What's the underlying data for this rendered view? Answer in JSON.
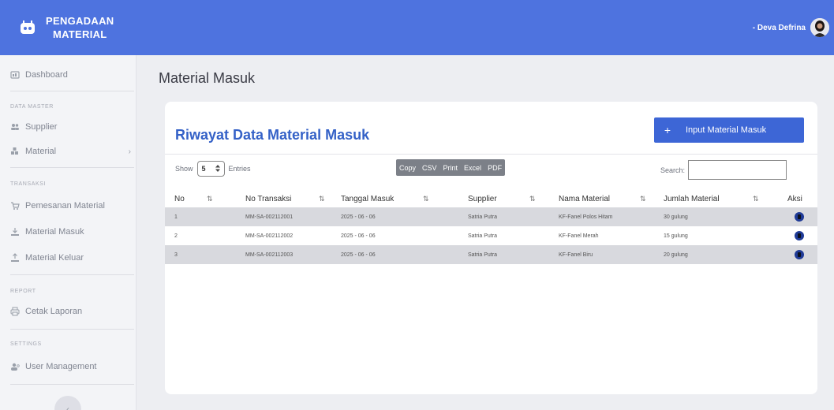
{
  "app": {
    "brand_line1": "PENGADAAN",
    "brand_line2": "MATERIAL",
    "user_name": "- Deva Defrina",
    "accent_color": "#4e73df"
  },
  "sidebar": {
    "dashboard": "Dashboard",
    "sec_master": "DATA MASTER",
    "supplier": "Supplier",
    "material": "Material",
    "sec_transaksi": "TRANSAKSI",
    "pemesanan": "Pemesanan Material",
    "masuk": "Material Masuk",
    "keluar": "Material Keluar",
    "sec_report": "REPORT",
    "cetak": "Cetak Laporan",
    "sec_settings": "SETTINGS",
    "user_mgmt": "User Management",
    "collapse": "‹"
  },
  "main": {
    "page_title": "Material Masuk",
    "card_title": "Riwayat Data Material Masuk",
    "input_button": "Input  Material Masuk",
    "show_label": "Show",
    "entries_label": "Entries",
    "page_size": "5",
    "export": [
      "Copy",
      "CSV",
      "Print",
      "Excel",
      "PDF"
    ],
    "search_label": "Search:"
  },
  "table": {
    "headers": [
      "No",
      "No Transaksi",
      "Tanggal Masuk",
      "Supplier",
      "Nama Material",
      "Jumlah Material",
      "Aksi"
    ],
    "rows": [
      {
        "no": "1",
        "trx": "MM-SA-002112001",
        "tgl": "2025 - 06 - 06",
        "supplier": "Satria Putra",
        "nama": "KF-Fanel Polos Hitam",
        "jumlah": "30 gulung"
      },
      {
        "no": "2",
        "trx": "MM-SA-002112002",
        "tgl": "2025 - 06 - 06",
        "supplier": "Satria Putra",
        "nama": "KF-Fanel Merah",
        "jumlah": "15 gulung"
      },
      {
        "no": "3",
        "trx": "MM-SA-002112003",
        "tgl": "2025 - 06 - 06",
        "supplier": "Satria Putra",
        "nama": "KF-Fanel Biru",
        "jumlah": "20 gulung"
      }
    ]
  }
}
